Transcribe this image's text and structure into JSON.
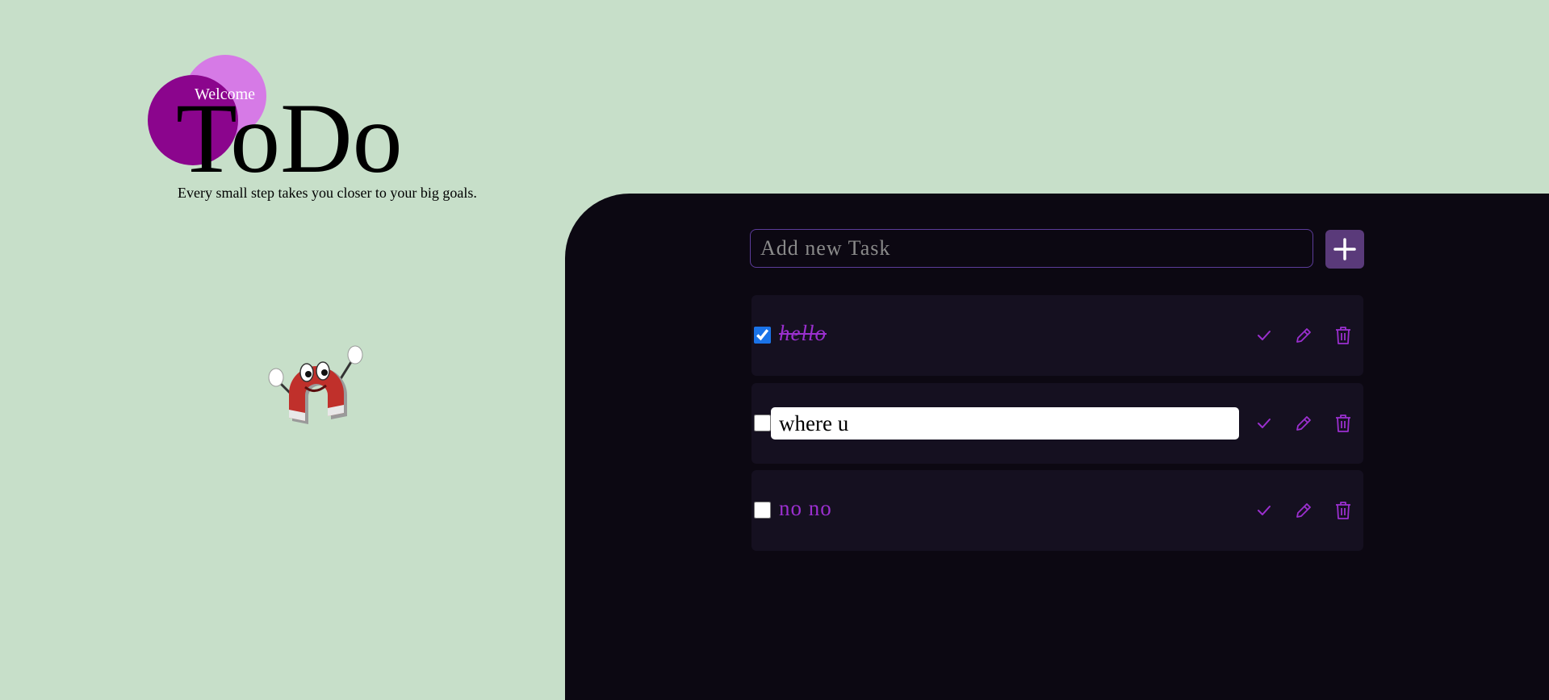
{
  "hero": {
    "welcome": "Welcome",
    "title": "ToDo",
    "tagline": "Every small step takes you closer to your big goals."
  },
  "mascot": {
    "icon": "magnet-mascot"
  },
  "task_input": {
    "placeholder": "Add new Task",
    "value": ""
  },
  "add_button": {
    "icon": "plus-icon"
  },
  "tasks": [
    {
      "label": "hello",
      "completed": true,
      "editing": false
    },
    {
      "label": "where u",
      "completed": false,
      "editing": true
    },
    {
      "label": "no no",
      "completed": false,
      "editing": false
    }
  ],
  "colors": {
    "background": "#c7dfc9",
    "panel": "#0c0812",
    "row": "#151020",
    "accent": "#9b2fcf",
    "circle_dark": "#8b058d",
    "circle_light": "#d67ae6",
    "add_button": "#5a3a7a"
  }
}
